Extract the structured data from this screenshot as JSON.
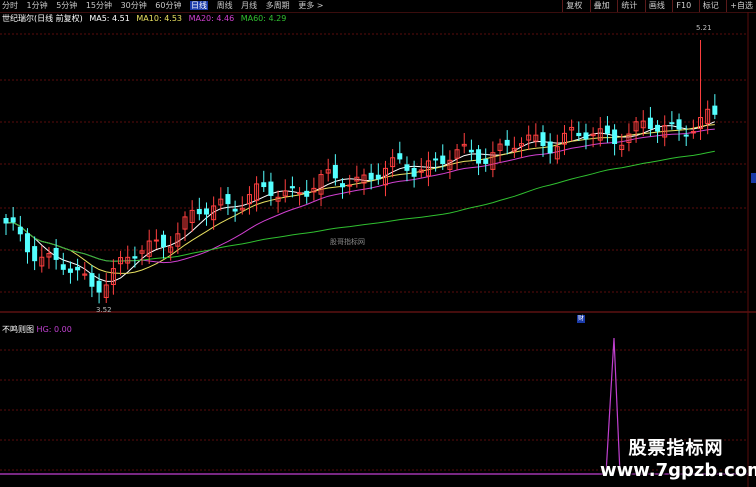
{
  "toolbar": {
    "periods": [
      "分时",
      "1分钟",
      "5分钟",
      "15分钟",
      "30分钟",
      "60分钟",
      "日线",
      "周线",
      "月线",
      "多周期",
      "更多 >"
    ],
    "active_period": "日线",
    "right_buttons": [
      "复权",
      "叠加",
      "统计",
      "画线",
      "F10",
      "标记",
      "+自选"
    ]
  },
  "legend": {
    "stock": "世纪瑞尔(日线 前复权)",
    "ma5": "MA5: 4.51",
    "ma10": "MA10: 4.53",
    "ma20": "MA20: 4.46",
    "ma60": "MA60: 4.29"
  },
  "colors": {
    "ma5": "#ffffff",
    "ma10": "#e8e060",
    "ma20": "#d040d0",
    "ma60": "#30c030",
    "up": "#ff4040",
    "down": "#54ffff",
    "grid": "#5a0d0d",
    "indicator": "#c040d0"
  },
  "annotations": {
    "high": "5.21",
    "low": "3.52"
  },
  "sub_panel": {
    "title": "不鸣则图",
    "value": "HG: 0.00"
  },
  "watermark": "股哥指标网",
  "brand": {
    "line1": "股票指标网",
    "line2": "www.7gpzb.com"
  },
  "chart_data": {
    "type": "candlestick",
    "low_marker": 3.52,
    "high_marker": 5.21
  }
}
